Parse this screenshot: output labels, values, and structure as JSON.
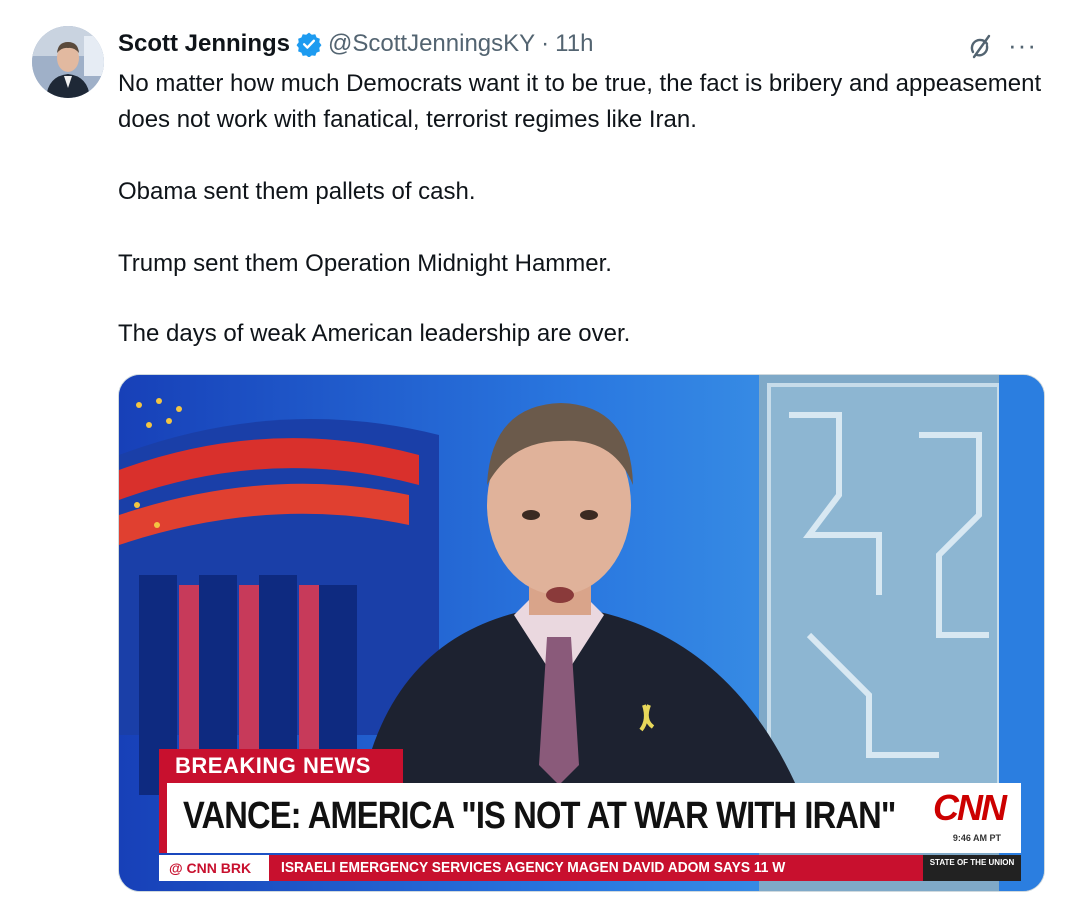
{
  "tweet": {
    "author": {
      "name": "Scott Jennings",
      "handle": "@ScottJenningsKY",
      "separator": "·",
      "time": "11h",
      "verified": true
    },
    "paragraphs": [
      "No matter how much Democrats want it to be true, the fact is bribery and appeasement does not work with fanatical, terrorist regimes like Iran.",
      "Obama sent them pallets of cash.",
      "Trump sent them Operation Midnight Hammer.",
      "The days of weak American leadership are over."
    ],
    "more_label": "···"
  },
  "media": {
    "breaking_label": "BREAKING NEWS",
    "headline": "VANCE: AMERICA \"IS NOT AT WAR WITH IRAN\"",
    "network_logo": "CNN",
    "time": "9:46 AM PT",
    "ticker_tag": "@ CNN BRK",
    "ticker_text": "ISRAELI EMERGENCY SERVICES AGENCY MAGEN DAVID ADOM SAYS 11 W",
    "show_name": "STATE OF THE UNION"
  },
  "icons": {
    "verified": "verified-badge-icon",
    "grok": "grok-icon",
    "more": "more-options-icon"
  },
  "colors": {
    "verified_blue": "#1d9bf0",
    "secondary_text": "#536471",
    "cnn_red": "#c8102e"
  }
}
